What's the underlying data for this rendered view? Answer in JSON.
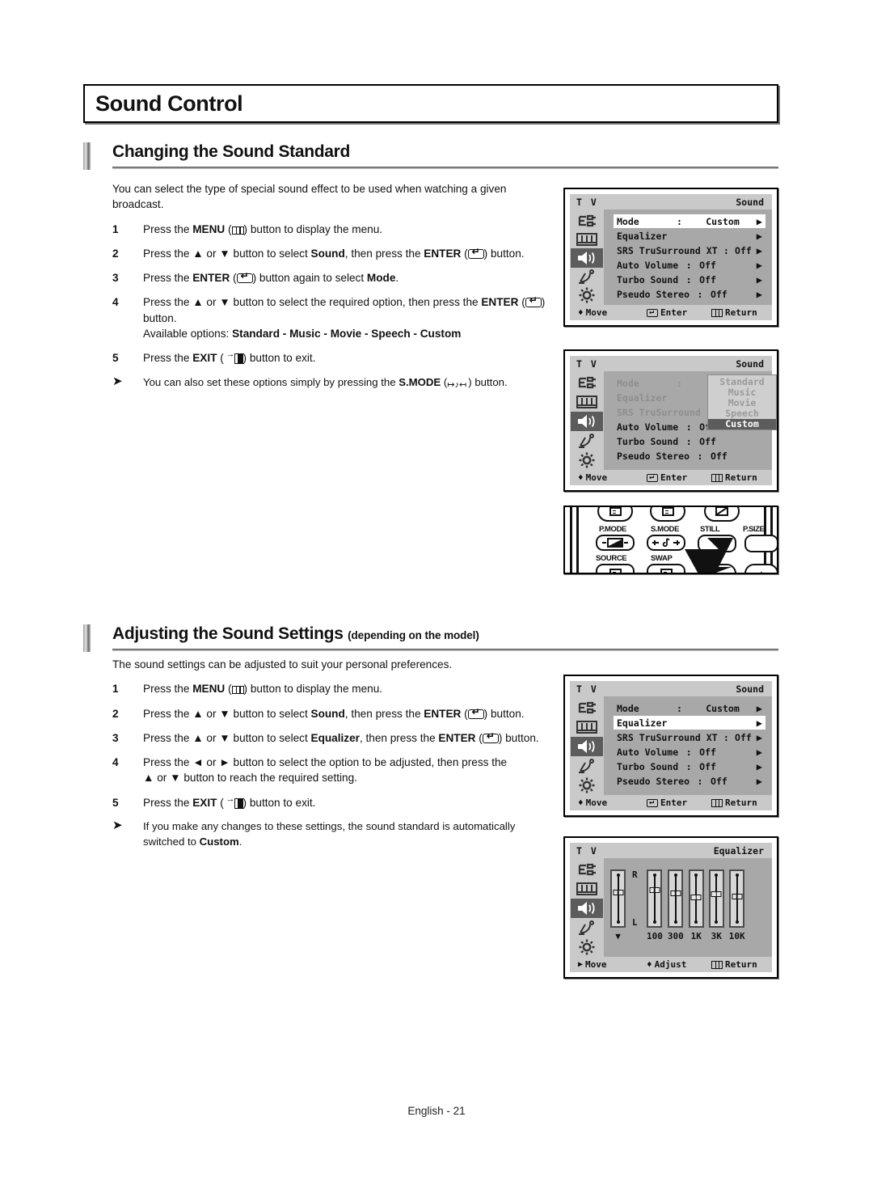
{
  "page": {
    "chapter_title": "Sound Control",
    "footer": "English - 21"
  },
  "sections": [
    {
      "heading": "Changing the Sound Standard",
      "heading_sub": "",
      "intro": "You can select the type of special sound effect to be used when watching a given broadcast.",
      "steps": [
        {
          "num": "1",
          "text_html": "Press the <b>MENU</b> (<span class=\"key k-menu\" data-name=\"menu-key-icon\"></span>) button to display the menu."
        },
        {
          "num": "2",
          "text_html": "Press the ▲ or ▼ button to select <b>Sound</b>, then press the <b>ENTER</b> (<span class=\"key k-enter\" data-name=\"enter-key-icon\"></span>) button."
        },
        {
          "num": "3",
          "text_html": "Press the <b>ENTER</b> (<span class=\"key k-enter\" data-name=\"enter-key-icon\"></span>) button again to select <b>Mode</b>."
        },
        {
          "num": "4",
          "text_html": "Press the ▲ or ▼ button to select the required option, then press the <b>ENTER</b> (<span class=\"key k-enter\" data-name=\"enter-key-icon\"></span>) button.<br>Available options: <b>Standard - Music - Movie - Speech - Custom</b>"
        },
        {
          "num": "5",
          "text_html": "Press the <b>EXIT</b> ( <span class=\"key k-exit\" data-name=\"exit-key-icon\"></span>) button to exit."
        }
      ],
      "note_html": "You can also set these options simply by pressing the <b>S.MODE</b> (<span class=\"key k-smode\" data-name=\"smode-key-icon\">↦♪↤</span>) button."
    },
    {
      "heading": "Adjusting the Sound Settings",
      "heading_sub": "(depending on the model)",
      "intro": "The sound settings can be adjusted to suit your personal preferences.",
      "steps": [
        {
          "num": "1",
          "text_html": "Press the <b>MENU</b> (<span class=\"key k-menu\" data-name=\"menu-key-icon\"></span>) button to display the menu."
        },
        {
          "num": "2",
          "text_html": "Press the ▲ or ▼ button to select <b>Sound</b>, then press the <b>ENTER</b> (<span class=\"key k-enter\" data-name=\"enter-key-icon\"></span>) button."
        },
        {
          "num": "3",
          "text_html": "Press the ▲ or ▼ button to select <b>Equalizer</b>, then press the <b>ENTER</b> (<span class=\"key k-enter\" data-name=\"enter-key-icon\"></span>) button."
        },
        {
          "num": "4",
          "text_html": "Press the ◄ or ► button to select the option to be adjusted, then press the<br>▲ or ▼ button to reach the required setting."
        },
        {
          "num": "5",
          "text_html": "Press the <b>EXIT</b> ( <span class=\"key k-exit\" data-name=\"exit-key-icon\"></span>) button to exit."
        }
      ],
      "note_html": "If you make any changes to these settings, the sound standard is automatically switched to <b>Custom</b>."
    }
  ],
  "osd": {
    "source_label": "T V",
    "sidebar_icons": [
      "input-source-icon",
      "picture-icon",
      "sound-speaker-icon",
      "satellite-dish-icon",
      "setup-gear-icon"
    ],
    "bottom_bar": {
      "move": "Move",
      "enter": "Enter",
      "return": "Return",
      "adjust": "Adjust"
    },
    "panels": [
      {
        "id": "sound-menu-mode-selected",
        "title": "Sound",
        "selected_row": 0,
        "rows": [
          {
            "label": "Mode",
            "colon": ":",
            "value": "Custom",
            "arrow": "▶"
          },
          {
            "label": "Equalizer",
            "colon": "",
            "value": "",
            "arrow": "▶"
          },
          {
            "label": "SRS TruSurround XT",
            "colon": ":",
            "value": "Off",
            "arrow": "▶"
          },
          {
            "label": "Auto Volume",
            "colon": ":",
            "value": "Off",
            "arrow": "▶"
          },
          {
            "label": "Turbo Sound",
            "colon": ":",
            "value": "Off",
            "arrow": "▶"
          },
          {
            "label": "Pseudo Stereo",
            "colon": ":",
            "value": "Off",
            "arrow": "▶"
          }
        ]
      },
      {
        "id": "sound-menu-mode-dropdown",
        "title": "Sound",
        "dropdown": {
          "options": [
            "Standard",
            "Music",
            "Movie",
            "Speech",
            "Custom"
          ],
          "current": "Custom"
        },
        "rows": [
          {
            "label": "Mode",
            "colon": ":",
            "value": "",
            "arrow": ""
          },
          {
            "label": "Equalizer",
            "colon": "",
            "value": "",
            "arrow": ""
          },
          {
            "label": "SRS TruSurround",
            "colon": "",
            "value": "",
            "arrow": ""
          },
          {
            "label": "Auto Volume",
            "colon": ":",
            "value": "Off",
            "arrow": ""
          },
          {
            "label": "Turbo Sound",
            "colon": ":",
            "value": "Off",
            "arrow": ""
          },
          {
            "label": "Pseudo Stereo",
            "colon": ":",
            "value": "Off",
            "arrow": ""
          }
        ]
      },
      {
        "id": "sound-menu-equalizer-selected",
        "title": "Sound",
        "selected_row": 1,
        "rows": [
          {
            "label": "Mode",
            "colon": ":",
            "value": "Custom",
            "arrow": "▶"
          },
          {
            "label": "Equalizer",
            "colon": "",
            "value": "",
            "arrow": "▶"
          },
          {
            "label": "SRS TruSurround XT",
            "colon": ":",
            "value": "Off",
            "arrow": "▶"
          },
          {
            "label": "Auto Volume",
            "colon": ":",
            "value": "Off",
            "arrow": "▶"
          },
          {
            "label": "Turbo Sound",
            "colon": ":",
            "value": "Off",
            "arrow": "▶"
          },
          {
            "label": "Pseudo Stereo",
            "colon": ":",
            "value": "Off",
            "arrow": "▶"
          }
        ]
      },
      {
        "id": "equalizer-screen",
        "title": "Equalizer",
        "bottom_bar": {
          "move": "Move",
          "adjust": "Adjust",
          "return": "Return"
        }
      }
    ]
  },
  "equalizer": {
    "balance": {
      "label": "▼",
      "top_mark": "R",
      "bottom_mark": "L",
      "position_pct": 50
    },
    "bands": [
      {
        "label": "100",
        "position_pct": 37
      },
      {
        "label": "300",
        "position_pct": 45
      },
      {
        "label": "1K",
        "position_pct": 57
      },
      {
        "label": "3K",
        "position_pct": 48
      },
      {
        "label": "10K",
        "position_pct": 54
      }
    ]
  },
  "remote": {
    "labels": [
      "P.MODE",
      "S.MODE",
      "STILL",
      "P.SIZE",
      "SOURCE",
      "SWAP"
    ],
    "pointer": "arrow-cursor-icon"
  },
  "colors": {
    "osd_bg": "#a8a8a8",
    "osd_bar": "#c9c9c9",
    "osd_highlight": "#ffffff",
    "osd_active_icon": "#5c5c5c",
    "text": "#111111"
  }
}
